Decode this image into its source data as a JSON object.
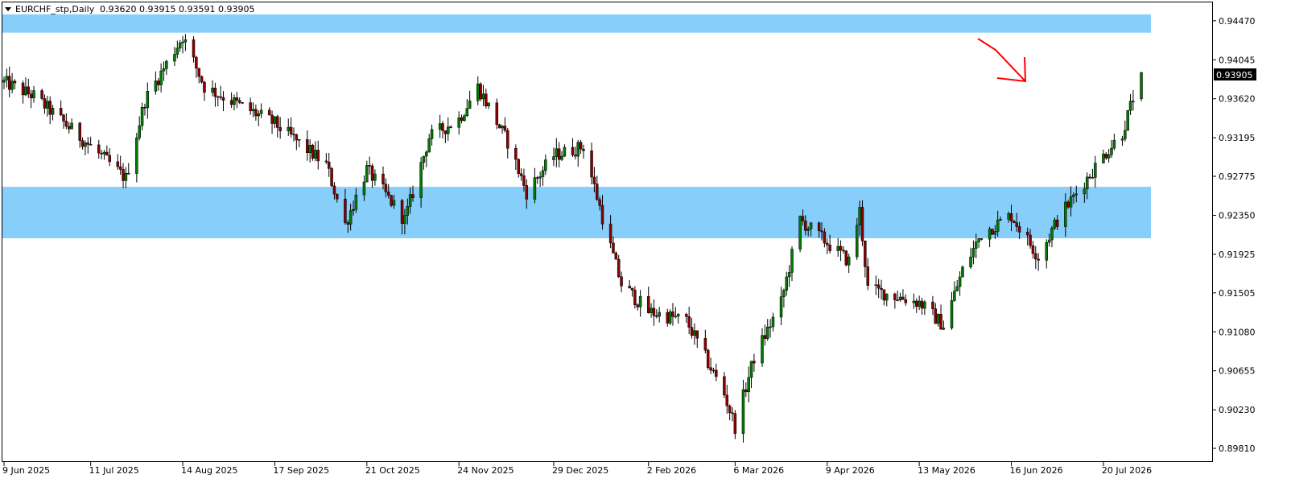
{
  "header": {
    "symbol": "EURCHF_stp,Daily",
    "ohlc": "0.93620 0.93915 0.93591 0.93905"
  },
  "colors": {
    "bull": "#007A00",
    "bear": "#8B0000",
    "wick": "#000000",
    "zone": "#87CEFA",
    "arrow": "#FF0000",
    "price_label_bg": "#000000",
    "price_label_text": "#FFFFFF"
  },
  "chart_data": {
    "type": "candlestick",
    "symbol": "EURCHF_stp",
    "timeframe": "Daily",
    "y_ticks": [
      "0.94470",
      "0.94045",
      "0.93620",
      "0.93195",
      "0.92775",
      "0.92350",
      "0.91925",
      "0.91505",
      "0.91080",
      "0.90655",
      "0.90230",
      "0.89810"
    ],
    "x_ticks": [
      "9 Jun 2025",
      "11 Jul 2025",
      "14 Aug 2025",
      "17 Sep 2025",
      "21 Oct 2025",
      "24 Nov 2025",
      "29 Dec 2025",
      "2 Feb 2026",
      "6 Mar 2026",
      "9 Apr 2026",
      "13 May 2026",
      "16 Jun 2026",
      "20 Jul 2026"
    ],
    "ylim": [
      0.8967,
      0.9467
    ],
    "current_price": "0.93905",
    "zones": [
      {
        "low": 0.9434,
        "high": 0.9454
      },
      {
        "low": 0.921,
        "high": 0.9266
      }
    ],
    "price_path": [
      {
        "date": "2025-06-09",
        "price": 0.938
      },
      {
        "date": "2025-06-20",
        "price": 0.9365
      },
      {
        "date": "2025-07-11",
        "price": 0.931
      },
      {
        "date": "2025-07-24",
        "price": 0.9275
      },
      {
        "date": "2025-07-31",
        "price": 0.936
      },
      {
        "date": "2025-08-14",
        "price": 0.943
      },
      {
        "date": "2025-08-22",
        "price": 0.9375
      },
      {
        "date": "2025-09-17",
        "price": 0.9335
      },
      {
        "date": "2025-10-06",
        "price": 0.929
      },
      {
        "date": "2025-10-13",
        "price": 0.9225
      },
      {
        "date": "2025-10-21",
        "price": 0.9285
      },
      {
        "date": "2025-11-04",
        "price": 0.923
      },
      {
        "date": "2025-11-13",
        "price": 0.932
      },
      {
        "date": "2025-11-24",
        "price": 0.934
      },
      {
        "date": "2025-12-01",
        "price": 0.9375
      },
      {
        "date": "2025-12-12",
        "price": 0.9315
      },
      {
        "date": "2025-12-19",
        "price": 0.926
      },
      {
        "date": "2025-12-29",
        "price": 0.93
      },
      {
        "date": "2026-01-09",
        "price": 0.931
      },
      {
        "date": "2026-01-19",
        "price": 0.92
      },
      {
        "date": "2026-01-23",
        "price": 0.916
      },
      {
        "date": "2026-02-02",
        "price": 0.913
      },
      {
        "date": "2026-02-16",
        "price": 0.912
      },
      {
        "date": "2026-03-02",
        "price": 0.904
      },
      {
        "date": "2026-03-06",
        "price": 0.9005
      },
      {
        "date": "2026-03-13",
        "price": 0.908
      },
      {
        "date": "2026-03-23",
        "price": 0.914
      },
      {
        "date": "2026-03-30",
        "price": 0.923
      },
      {
        "date": "2026-04-09",
        "price": 0.9205
      },
      {
        "date": "2026-04-17",
        "price": 0.9185
      },
      {
        "date": "2026-04-21",
        "price": 0.924
      },
      {
        "date": "2026-04-24",
        "price": 0.9155
      },
      {
        "date": "2026-05-13",
        "price": 0.914
      },
      {
        "date": "2026-05-22",
        "price": 0.9115
      },
      {
        "date": "2026-05-29",
        "price": 0.9175
      },
      {
        "date": "2026-06-05",
        "price": 0.9215
      },
      {
        "date": "2026-06-16",
        "price": 0.9235
      },
      {
        "date": "2026-06-26",
        "price": 0.919
      },
      {
        "date": "2026-07-03",
        "price": 0.923
      },
      {
        "date": "2026-07-09",
        "price": 0.9255
      },
      {
        "date": "2026-07-20",
        "price": 0.93
      },
      {
        "date": "2026-07-27",
        "price": 0.9325
      },
      {
        "date": "2026-08-03",
        "price": 0.93905
      }
    ]
  }
}
